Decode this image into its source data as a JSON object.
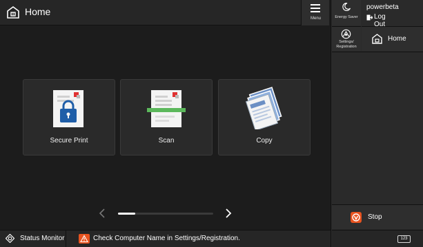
{
  "header": {
    "title": "Home",
    "menu_label": "Menu"
  },
  "right_panel": {
    "energy_saver_label": "Energy Saver",
    "user_name": "powerbeta",
    "logout_label": "Log Out",
    "settings_label_line1": "Settings/",
    "settings_label_line2": "Registration",
    "home_label": "Home",
    "stop_label": "Stop"
  },
  "tiles": [
    {
      "label": "Secure Print",
      "icon": "secure-print-icon"
    },
    {
      "label": "Scan",
      "icon": "scan-icon"
    },
    {
      "label": "Copy",
      "icon": "copy-icon"
    }
  ],
  "pager": {
    "position_fraction": 0.0
  },
  "status_bar": {
    "status_monitor_label": "Status Monitor",
    "message": "Check Computer Name in Settings/Registration.",
    "keyboard_label": "123"
  },
  "colors": {
    "accent_orange": "#e8531f",
    "scan_green": "#5cb85c",
    "lock_blue": "#1f5ea8",
    "doc_red": "#e03131"
  }
}
